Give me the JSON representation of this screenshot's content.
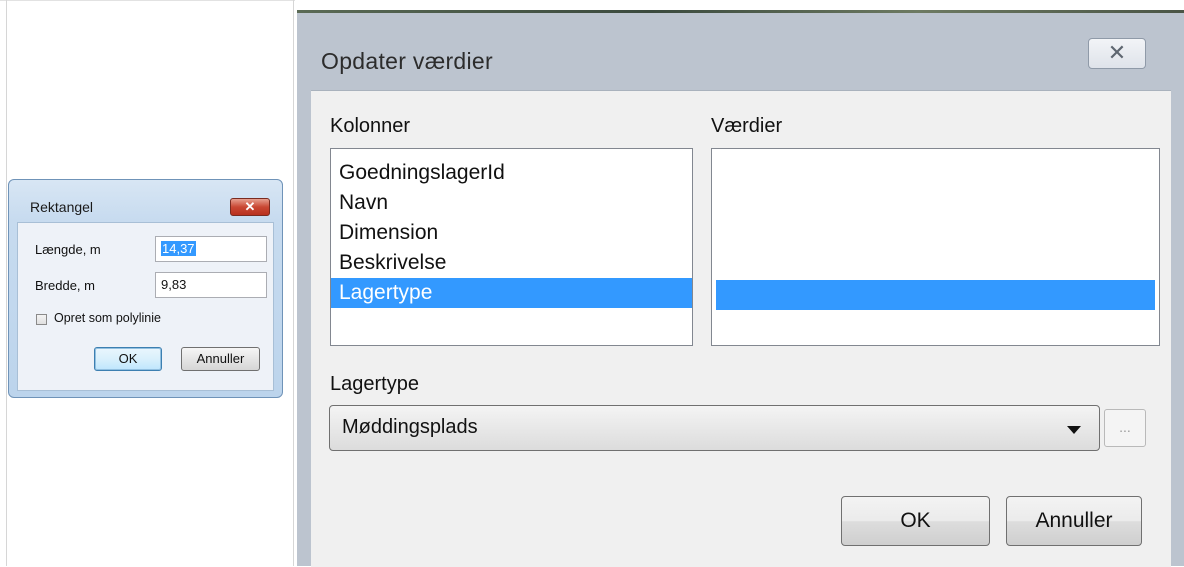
{
  "rektangel_dialog": {
    "title": "Rektangel",
    "close_glyph": "✕",
    "length_label": "Længde, m",
    "length_value": "14,37",
    "width_label": "Bredde, m",
    "width_value": "9,83",
    "polyline_checkbox_label": "Opret som polylinie",
    "polyline_checked": false,
    "ok_label": "OK",
    "cancel_label": "Annuller"
  },
  "update_dialog": {
    "title": "Opdater værdier",
    "close_glyph": "✕",
    "columns_header": "Kolonner",
    "values_header": "Værdier",
    "columns": [
      {
        "label": "GoedningslagerId",
        "selected": false
      },
      {
        "label": "Navn",
        "selected": false
      },
      {
        "label": "Dimension",
        "selected": false
      },
      {
        "label": "Beskrivelse",
        "selected": false
      },
      {
        "label": "Lagertype",
        "selected": true
      }
    ],
    "field_label": "Lagertype",
    "dropdown_value": "Møddingsplads",
    "ellipsis_label": "...",
    "ok_label": "OK",
    "cancel_label": "Annuller"
  },
  "colors": {
    "selection": "#3399ff",
    "close_red": "#c94733",
    "dialog_frame_blue": "#bcd4ec"
  }
}
